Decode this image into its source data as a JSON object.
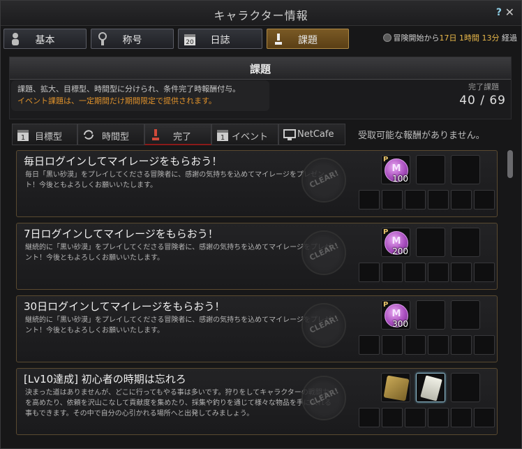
{
  "window": {
    "title": "キャラクター情報",
    "help": "?",
    "close": "✕"
  },
  "main_tabs": [
    {
      "label": "基本",
      "icon": "person-icon"
    },
    {
      "label": "称号",
      "icon": "medal-icon"
    },
    {
      "label": "日誌",
      "icon": "calendar-icon"
    },
    {
      "label": "課題",
      "icon": "trophy-icon"
    }
  ],
  "elapsed": {
    "prefix": "冒険開始から",
    "day": "17日",
    "hour": "1時間",
    "min": "13分",
    "suffix": "経過"
  },
  "panel": {
    "title": "課題",
    "desc_line1": "課題、拡大、目標型、時間型に分けられ、条件完了時報酬付与。",
    "desc_line2": "イベント課題は、一定期間だけ期間限定で提供されます。",
    "done_label": "完了課題",
    "done_count": "40 / 69"
  },
  "sub_tabs": [
    {
      "label": "目標型",
      "icon": "calendar-icon"
    },
    {
      "label": "時間型",
      "icon": "refresh-icon"
    },
    {
      "label": "完了",
      "icon": "trophy-icon"
    },
    {
      "label": "イベント",
      "icon": "calendar-icon"
    },
    {
      "label": "NetCafe",
      "icon": "monitor-icon"
    }
  ],
  "no_reward": "受取可能な報酬がありません。",
  "stamp_text": "CLEAR!",
  "cards": [
    {
      "title": "毎日ログインしてマイレージをもらおう！",
      "desc": "毎日「黒い砂漠」をプレイしてくださる冒険者に、感謝の気持ちを込めてマイレージをプレゼント！今後ともよろしくお願いいたします。",
      "reward_badge": "P",
      "reward_letter": "M",
      "reward_qty": "100"
    },
    {
      "title": "7日ログインしてマイレージをもらおう！",
      "desc": "継続的に「黒い砂漠」をプレイしてくださる冒険者に、感謝の気持ちを込めてマイレージをプレゼント！今後ともよろしくお願いいたします。",
      "reward_badge": "P",
      "reward_letter": "M",
      "reward_qty": "200"
    },
    {
      "title": "30日ログインしてマイレージをもらおう！",
      "desc": "継続的に「黒い砂漠」をプレイしてくださる冒険者に、感謝の気持ちを込めてマイレージをプレゼント！今後ともよろしくお願いいたします。",
      "reward_badge": "P",
      "reward_letter": "M",
      "reward_qty": "300"
    },
    {
      "title": "[Lv10達成] 初心者の時期は忘れろ",
      "desc": "決まった道はありませんが、どこに行ってもやる事は多いです。狩りをしてキャラクターの戦闘力を高めたり、依頼を沢山こなして貢献度を集めたり、採集や釣りを通じて様々な物品を手に入れる事もできます。その中で自分の心引かれる場所へと出発してみましょう。",
      "reward_badge": "",
      "reward_letter": "",
      "reward_qty": ""
    }
  ]
}
